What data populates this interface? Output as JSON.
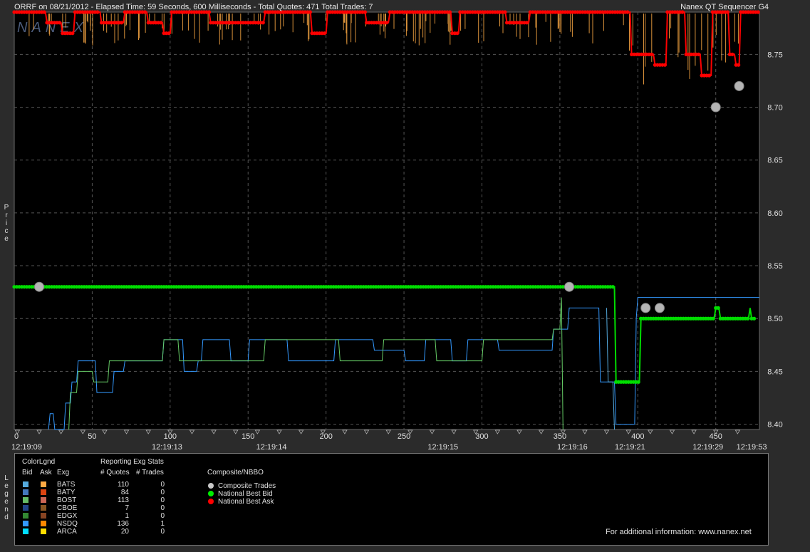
{
  "header": {
    "left": "ORRF on 08/21/2012  -  Elapsed Time: 59 Seconds, 600 Milliseconds  -  Total Quotes: 471  Total Trades: 7",
    "right": "Nanex QT Sequencer G4",
    "watermark": "NANEX"
  },
  "axis_titles": {
    "price": "Price",
    "legend": "Legend"
  },
  "chart_data": {
    "type": "line",
    "xlim": [
      0,
      478
    ],
    "ylim": [
      8.395,
      8.79
    ],
    "y_ticks": [
      "8.75",
      "8.70",
      "8.65",
      "8.60",
      "8.55",
      "8.50",
      "8.45",
      "8.40"
    ],
    "x_ticks": [
      "0",
      "50",
      "100",
      "150",
      "200",
      "250",
      "300",
      "350",
      "400",
      "450"
    ],
    "time_labels": [
      {
        "x": 8,
        "label": "12:19:09"
      },
      {
        "x": 98,
        "label": "12:19:13"
      },
      {
        "x": 165,
        "label": "12:19:14"
      },
      {
        "x": 275,
        "label": "12:19:15"
      },
      {
        "x": 358,
        "label": "12:19:16"
      },
      {
        "x": 395,
        "label": "12:19:21"
      },
      {
        "x": 445,
        "label": "12:19:29"
      },
      {
        "x": 473,
        "label": "12:19:53"
      }
    ],
    "series": [
      {
        "name": "Composite Trades",
        "color": "#b4b4b4",
        "points": [
          [
            16,
            8.53
          ],
          [
            356,
            8.53
          ],
          [
            405,
            8.51
          ],
          [
            414,
            8.51
          ],
          [
            450,
            8.7
          ],
          [
            465,
            8.72
          ]
        ]
      },
      {
        "name": "National Best Bid",
        "color": "#00dd00",
        "points": [
          [
            0,
            8.53
          ],
          [
            385,
            8.53
          ],
          [
            386,
            8.44
          ],
          [
            401,
            8.44
          ],
          [
            402,
            8.5
          ],
          [
            449,
            8.5
          ],
          [
            450,
            8.51
          ],
          [
            452,
            8.51
          ],
          [
            453,
            8.5
          ],
          [
            471,
            8.5
          ],
          [
            472,
            8.51
          ],
          [
            473,
            8.5
          ],
          [
            475,
            8.5
          ]
        ]
      },
      {
        "name": "National Best Ask",
        "color": "#ff0000",
        "points": [
          [
            0,
            8.79
          ],
          [
            20,
            8.79
          ],
          [
            21,
            8.78
          ],
          [
            30,
            8.78
          ],
          [
            31,
            8.77
          ],
          [
            38,
            8.77
          ],
          [
            39,
            8.79
          ],
          [
            55,
            8.79
          ],
          [
            56,
            8.78
          ],
          [
            70,
            8.78
          ],
          [
            71,
            8.79
          ],
          [
            85,
            8.79
          ],
          [
            86,
            8.78
          ],
          [
            95,
            8.78
          ],
          [
            96,
            8.77
          ],
          [
            100,
            8.77
          ],
          [
            101,
            8.79
          ],
          [
            125,
            8.79
          ],
          [
            126,
            8.78
          ],
          [
            160,
            8.78
          ],
          [
            161,
            8.79
          ],
          [
            190,
            8.79
          ],
          [
            191,
            8.77
          ],
          [
            200,
            8.77
          ],
          [
            201,
            8.79
          ],
          [
            225,
            8.79
          ],
          [
            226,
            8.78
          ],
          [
            240,
            8.78
          ],
          [
            241,
            8.79
          ],
          [
            280,
            8.79
          ],
          [
            281,
            8.77
          ],
          [
            285,
            8.77
          ],
          [
            286,
            8.79
          ],
          [
            315,
            8.79
          ],
          [
            316,
            8.78
          ],
          [
            330,
            8.78
          ],
          [
            331,
            8.79
          ],
          [
            395,
            8.79
          ],
          [
            396,
            8.75
          ],
          [
            410,
            8.75
          ],
          [
            411,
            8.74
          ],
          [
            418,
            8.74
          ],
          [
            419,
            8.79
          ],
          [
            430,
            8.79
          ],
          [
            431,
            8.75
          ],
          [
            440,
            8.75
          ],
          [
            441,
            8.73
          ],
          [
            447,
            8.73
          ],
          [
            448,
            8.79
          ],
          [
            458,
            8.79
          ],
          [
            459,
            8.75
          ],
          [
            462,
            8.75
          ],
          [
            463,
            8.74
          ],
          [
            465,
            8.74
          ],
          [
            466,
            8.79
          ],
          [
            478,
            8.79
          ]
        ]
      },
      {
        "name": "NSDQ Bid",
        "color": "#3399ff",
        "points": [
          [
            22,
            8.395
          ],
          [
            23,
            8.41
          ],
          [
            25,
            8.41
          ],
          [
            26,
            8.395
          ],
          [
            32,
            8.395
          ],
          [
            33,
            8.42
          ],
          [
            36,
            8.42
          ],
          [
            37,
            8.44
          ],
          [
            40,
            8.44
          ],
          [
            41,
            8.46
          ],
          [
            52,
            8.46
          ],
          [
            53,
            8.43
          ],
          [
            63,
            8.43
          ],
          [
            64,
            8.45
          ],
          [
            70,
            8.45
          ],
          [
            71,
            8.46
          ],
          [
            95,
            8.46
          ],
          [
            96,
            8.48
          ],
          [
            108,
            8.48
          ],
          [
            109,
            8.45
          ],
          [
            117,
            8.45
          ],
          [
            118,
            8.46
          ],
          [
            120,
            8.46
          ],
          [
            121,
            8.48
          ],
          [
            138,
            8.48
          ],
          [
            139,
            8.46
          ],
          [
            150,
            8.46
          ],
          [
            151,
            8.48
          ],
          [
            175,
            8.48
          ],
          [
            176,
            8.46
          ],
          [
            205,
            8.46
          ],
          [
            206,
            8.48
          ],
          [
            230,
            8.48
          ],
          [
            231,
            8.47
          ],
          [
            250,
            8.47
          ],
          [
            251,
            8.46
          ],
          [
            263,
            8.46
          ],
          [
            264,
            8.48
          ],
          [
            280,
            8.48
          ],
          [
            281,
            8.46
          ],
          [
            290,
            8.46
          ],
          [
            291,
            8.48
          ],
          [
            310,
            8.48
          ],
          [
            311,
            8.47
          ],
          [
            345,
            8.47
          ],
          [
            346,
            8.49
          ],
          [
            355,
            8.49
          ],
          [
            356,
            8.51
          ],
          [
            375,
            8.51
          ],
          [
            376,
            8.44
          ],
          [
            385,
            8.44
          ],
          [
            386,
            8.4
          ],
          [
            398,
            8.4
          ],
          [
            399,
            8.5
          ],
          [
            400,
            8.52
          ],
          [
            478,
            8.52
          ]
        ]
      },
      {
        "name": "BOST Bid",
        "color": "#66cc66",
        "points": [
          [
            35,
            8.395
          ],
          [
            36,
            8.43
          ],
          [
            40,
            8.43
          ],
          [
            41,
            8.45
          ],
          [
            50,
            8.45
          ],
          [
            51,
            8.44
          ],
          [
            60,
            8.44
          ],
          [
            61,
            8.46
          ],
          [
            95,
            8.46
          ],
          [
            96,
            8.48
          ],
          [
            105,
            8.48
          ],
          [
            106,
            8.46
          ],
          [
            160,
            8.46
          ],
          [
            161,
            8.48
          ],
          [
            208,
            8.48
          ],
          [
            209,
            8.46
          ],
          [
            236,
            8.46
          ],
          [
            237,
            8.48
          ],
          [
            270,
            8.48
          ],
          [
            271,
            8.46
          ],
          [
            300,
            8.46
          ],
          [
            301,
            8.48
          ],
          [
            345,
            8.48
          ],
          [
            346,
            8.49
          ],
          [
            350,
            8.49
          ],
          [
            351,
            8.52
          ],
          [
            352,
            8.395
          ]
        ]
      },
      {
        "name": "BATS Bid",
        "color": "#55aadd",
        "points": [
          [
            380,
            8.51
          ],
          [
            381,
            8.44
          ],
          [
            384,
            8.44
          ],
          [
            385,
            8.395
          ]
        ]
      },
      {
        "name": "Ask Tick Marks",
        "color": "#ffaa44",
        "points": []
      }
    ]
  },
  "legend": {
    "colorlgnd_title": "ColorLgnd",
    "col_bid": "Bid",
    "col_ask": "Ask",
    "col_exg": "Exg",
    "stats_title": "Reporting Exg Stats",
    "col_quotes": "# Quotes",
    "col_trades": "# Trades",
    "rows": [
      {
        "exg": "BATS",
        "quotes": "110",
        "trades": "0",
        "bid_color": "#55aadd",
        "ask_color": "#ffaa44"
      },
      {
        "exg": "BATY",
        "quotes": "84",
        "trades": "0",
        "bid_color": "#4477bb",
        "ask_color": "#dd4411"
      },
      {
        "exg": "BOST",
        "quotes": "113",
        "trades": "0",
        "bid_color": "#66bb66",
        "ask_color": "#cc6655"
      },
      {
        "exg": "CBOE",
        "quotes": "7",
        "trades": "0",
        "bid_color": "#224488",
        "ask_color": "#885522"
      },
      {
        "exg": "EDGX",
        "quotes": "1",
        "trades": "0",
        "bid_color": "#338833",
        "ask_color": "#884422"
      },
      {
        "exg": "NSDQ",
        "quotes": "136",
        "trades": "1",
        "bid_color": "#3399ff",
        "ask_color": "#ff8800"
      },
      {
        "exg": "ARCA",
        "quotes": "20",
        "trades": "0",
        "bid_color": "#00ddff",
        "ask_color": "#ffdd00"
      }
    ],
    "composite_title": "Composite/NBBO",
    "composite_items": [
      {
        "label": "Composite Trades",
        "color": "#c8c8c8"
      },
      {
        "label": "National Best Bid",
        "color": "#00ee00"
      },
      {
        "label": "National Best Ask",
        "color": "#ff0000"
      }
    ],
    "footer": "For additional information: www.nanex.net"
  }
}
